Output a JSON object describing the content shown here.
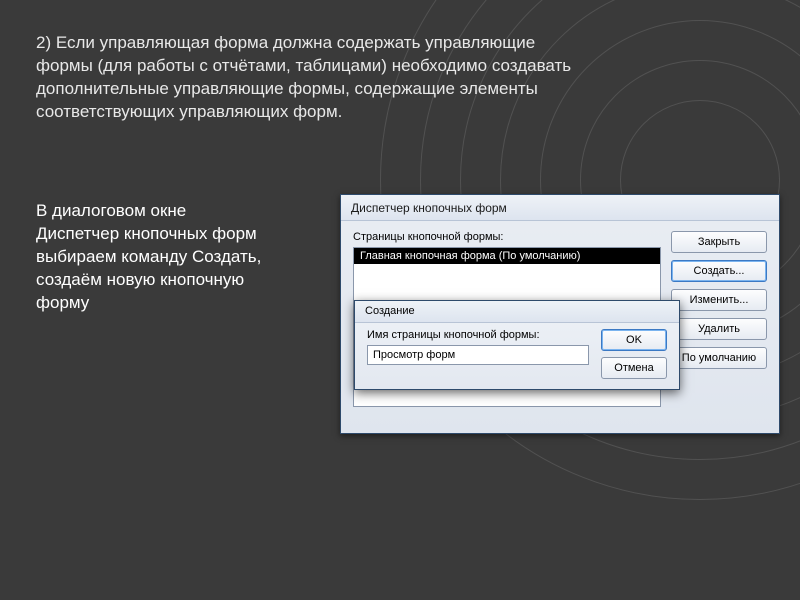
{
  "slide": {
    "top_text": "2) Если управляющая форма должна содержать управляющие формы (для работы с отчётами, таблицами) необходимо создавать дополнительные управляющие формы, содержащие элементы соответствующих управляющих форм.",
    "side_text": "В диалоговом окне Диспетчер кнопочных форм выбираем команду Создать, создаём новую кнопочную форму"
  },
  "dispatcher": {
    "title": "Диспетчер кнопочных форм",
    "list_label": "Страницы кнопочной формы:",
    "items": [
      "Главная кнопочная форма (По умолчанию)"
    ],
    "buttons": {
      "close": "Закрыть",
      "create": "Создать...",
      "edit": "Изменить...",
      "delete": "Удалить",
      "default": "По умолчанию"
    }
  },
  "create_dialog": {
    "title": "Создание",
    "label": "Имя страницы кнопочной формы:",
    "value": "Просмотр форм",
    "ok": "OK",
    "cancel": "Отмена"
  }
}
